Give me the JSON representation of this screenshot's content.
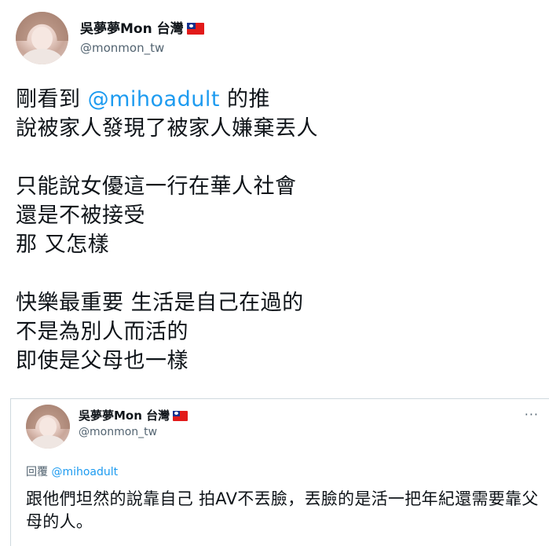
{
  "author": {
    "name": "吳夢夢Mon 台灣",
    "handle": "@monmon_tw",
    "flag_icon": "taiwan-flag-icon"
  },
  "tweet": {
    "line1_prefix": "剛看到 ",
    "line1_mention": "@mihoadult",
    "line1_suffix": " 的推",
    "rest": "說被家人發現了被家人嫌棄丟人\n\n只能說女優這一行在華人社會\n還是不被接受\n那 又怎樣\n\n快樂最重要 生活是自己在過的\n不是為別人而活的\n即使是父母也一樣"
  },
  "quoted": {
    "name": "吳夢夢Mon 台灣",
    "handle": "@monmon_tw",
    "more_icon": "more-icon",
    "reply_label": "回覆 ",
    "reply_mention": "@mihoadult",
    "text": "跟他們坦然的說靠自己 拍AV不丟臉，丟臉的是活一把年紀還需要靠父母的人。"
  },
  "colors": {
    "link": "#1d9bf0",
    "secondary_text": "#536471",
    "border": "#cfd9de"
  }
}
